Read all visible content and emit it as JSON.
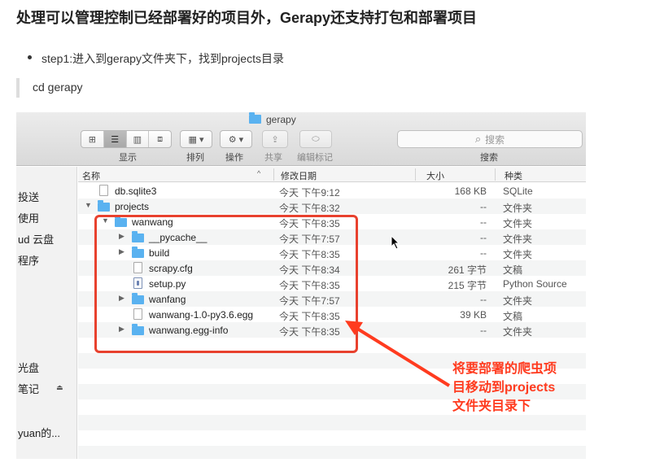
{
  "article": {
    "heading": "处理可以管理控制已经部署好的项目外，Gerapy还支持打包和部署项目",
    "step": "step1:进入到gerapy文件夹下，找到projects目录",
    "command": "cd gerapy"
  },
  "finder": {
    "window_title": "gerapy",
    "toolbar": {
      "view_label": "显示",
      "arrange_label": "排列",
      "action_label": "操作",
      "share_label": "共享",
      "tags_label": "编辑标记",
      "search_placeholder": "搜索",
      "search_label": "搜索"
    },
    "sidebar": [
      {
        "label": "投送"
      },
      {
        "label": "使用"
      },
      {
        "label": "ud 云盘"
      },
      {
        "label": "程序"
      },
      {
        "label": "光盘"
      },
      {
        "label": "笔记"
      },
      {
        "label": "yuan的..."
      }
    ],
    "columns": {
      "name": "名称",
      "date": "修改日期",
      "size": "大小",
      "kind": "种类"
    },
    "rows": [
      {
        "name": "db.sqlite3",
        "date": "今天 下午9:12",
        "size": "168 KB",
        "kind": "SQLite",
        "type": "file",
        "indent": 0
      },
      {
        "name": "projects",
        "date": "今天 下午8:32",
        "size": "--",
        "kind": "文件夹",
        "type": "folder",
        "expanded": true,
        "indent": 0
      },
      {
        "name": "wanwang",
        "date": "今天 下午8:35",
        "size": "--",
        "kind": "文件夹",
        "type": "folder",
        "expanded": true,
        "indent": 1
      },
      {
        "name": "__pycache__",
        "date": "今天 下午7:57",
        "size": "--",
        "kind": "文件夹",
        "type": "folder",
        "expanded": false,
        "indent": 2
      },
      {
        "name": "build",
        "date": "今天 下午8:35",
        "size": "--",
        "kind": "文件夹",
        "type": "folder",
        "expanded": false,
        "indent": 2
      },
      {
        "name": "scrapy.cfg",
        "date": "今天 下午8:34",
        "size": "261 字节",
        "kind": "文稿",
        "type": "file",
        "indent": 2
      },
      {
        "name": "setup.py",
        "date": "今天 下午8:35",
        "size": "215 字节",
        "kind": "Python Source",
        "type": "python",
        "indent": 2
      },
      {
        "name": "wanfang",
        "date": "今天 下午7:57",
        "size": "--",
        "kind": "文件夹",
        "type": "folder",
        "expanded": false,
        "indent": 2
      },
      {
        "name": "wanwang-1.0-py3.6.egg",
        "date": "今天 下午8:35",
        "size": "39 KB",
        "kind": "文稿",
        "type": "file",
        "indent": 2
      },
      {
        "name": "wanwang.egg-info",
        "date": "今天 下午8:35",
        "size": "--",
        "kind": "文件夹",
        "type": "folder",
        "expanded": false,
        "indent": 2
      }
    ]
  },
  "annotation": {
    "line1": "将要部署的爬虫项",
    "line2": "目移动到projects",
    "line3": "文件夹目录下"
  },
  "colors": {
    "annotation_red": "#ff3b1f",
    "folder_blue": "#5ab2f0"
  }
}
